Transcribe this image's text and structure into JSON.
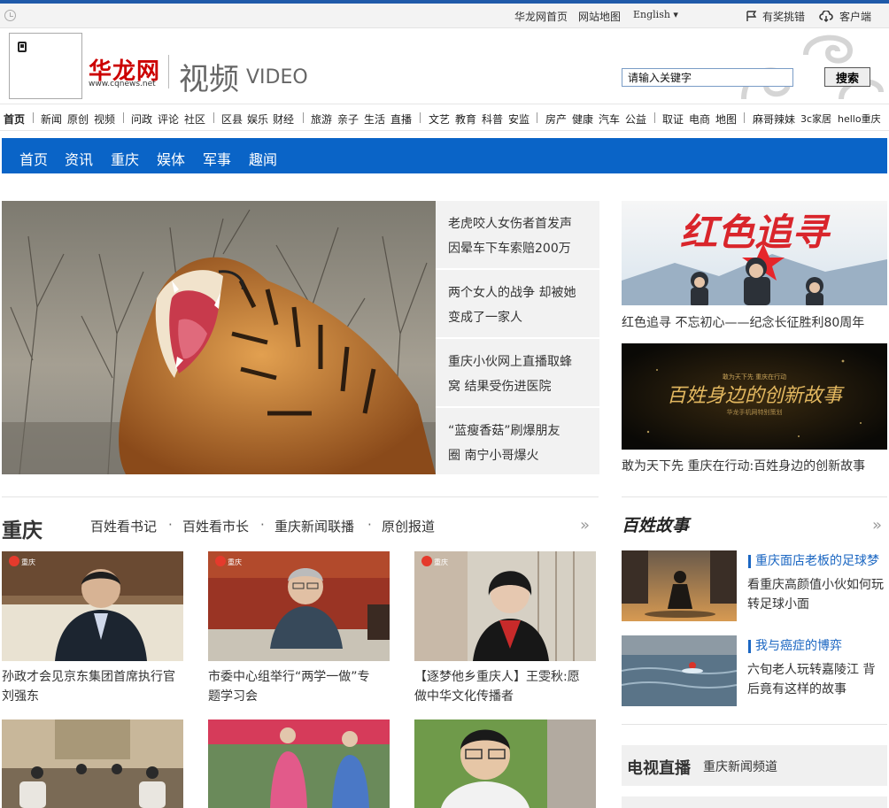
{
  "utility_bar": {
    "links": [
      "华龙网首页",
      "网站地图",
      "English"
    ],
    "award_label": "有奖挑错",
    "client_label": "客户端"
  },
  "header": {
    "brand": "华龙网",
    "brand_url": "www.cqnews.net",
    "channel": "视频",
    "channel_en": "VIDEO",
    "search_placeholder": "请输入关键字",
    "search_button": "搜索"
  },
  "category_nav": [
    [
      "首页"
    ],
    [
      "新闻",
      "原创",
      "视频"
    ],
    [
      "问政",
      "评论",
      "社区"
    ],
    [
      "区县",
      "娱乐",
      "财经"
    ],
    [
      "旅游",
      "亲子",
      "生活",
      "直播"
    ],
    [
      "文艺",
      "教育",
      "科普",
      "安监"
    ],
    [
      "房产",
      "健康",
      "汽车",
      "公益"
    ],
    [
      "取证",
      "电商",
      "地图"
    ],
    [
      "麻哥辣妹",
      "3c家居",
      "hello重庆"
    ]
  ],
  "sub_nav": [
    "首页",
    "资讯",
    "重庆",
    "娱体",
    "军事",
    "趣闻"
  ],
  "hero": {
    "headlines": [
      [
        "老虎咬人女伤者首发声",
        "因晕车下车索赔200万"
      ],
      [
        "两个女人的战争 却被她",
        "变成了一家人"
      ],
      [
        "重庆小伙网上直播取蜂",
        "窝 结果受伤进医院"
      ],
      [
        "“蓝瘦香菇”刷爆朋友",
        "圈 南宁小哥爆火"
      ]
    ]
  },
  "right_features": [
    {
      "banner_text": "红色追寻",
      "caption": "红色追寻 不忘初心——纪念长征胜利80周年"
    },
    {
      "banner_text": "百姓身边的创新故事",
      "banner_top": "敢为天下先 重庆在行动",
      "banner_sub": "华龙手机网特别策划",
      "caption": "敢为天下先 重庆在行动:百姓身边的创新故事"
    }
  ],
  "chongqing": {
    "title": "重庆",
    "links": [
      "百姓看书记",
      "百姓看市长",
      "重庆新闻联播",
      "原创报道"
    ],
    "cards": [
      [
        "孙政才会见京东集团首席执行官",
        "刘强东"
      ],
      [
        "市委中心组举行“两学一做”专",
        "题学习会"
      ],
      [
        "【逐梦他乡重庆人】王雯秋:愿",
        "做中华文化传播者"
      ]
    ],
    "thumb_badge": "重庆"
  },
  "stories": {
    "title": "百姓故事",
    "items": [
      {
        "title": "重庆面店老板的足球梦",
        "desc": [
          "看重庆高颜值小伙如何玩",
          "转足球小面"
        ]
      },
      {
        "title": "我与癌症的博弈",
        "desc": [
          "六旬老人玩转嘉陵江 背",
          "后竟有这样的故事"
        ]
      }
    ]
  },
  "tv": {
    "title": "电视直播",
    "channel": "重庆新闻频道"
  }
}
